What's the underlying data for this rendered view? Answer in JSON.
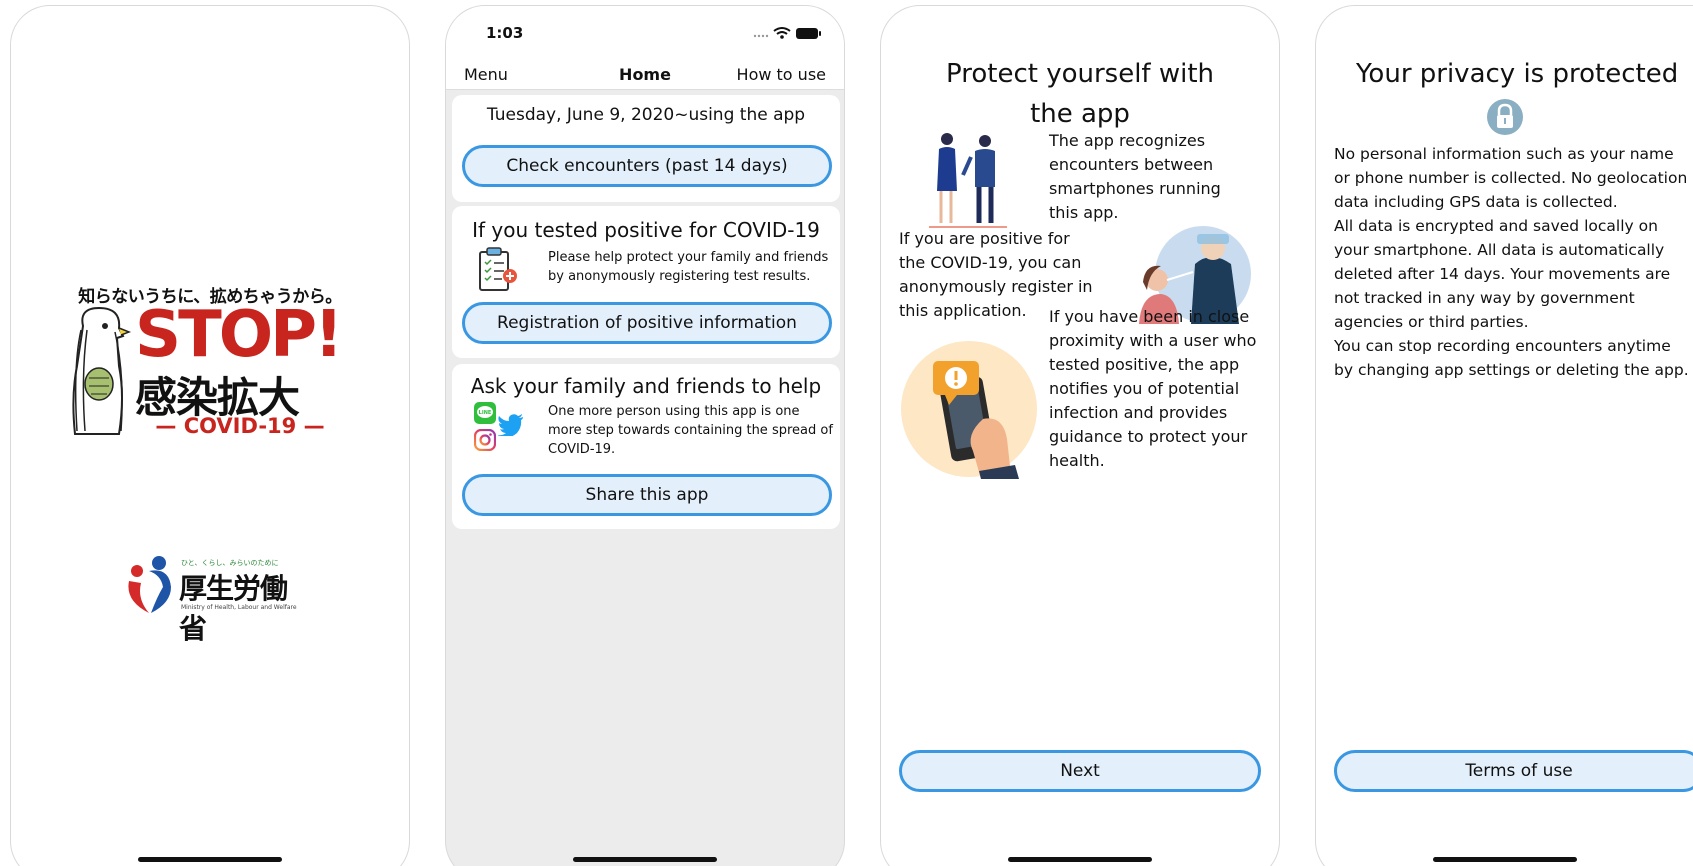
{
  "splash": {
    "slogan": "知らないうちに、拡めちゃうから。",
    "stop": "STOP!",
    "kanji": "感染拡大",
    "covid": "— COVID-19 —",
    "ministry_tagline": "ひと、くらし、みらいのために",
    "ministry_name": "厚生労働省",
    "ministry_en": "Ministry of Health, Labour and Welfare"
  },
  "home": {
    "status_time": "1:03",
    "nav": {
      "left": "Menu",
      "center": "Home",
      "right": "How to use"
    },
    "usage_line": "Tuesday, June 9, 2020~using the app",
    "check_button": "Check encounters (past 14 days)",
    "positive_title": "If you tested positive for COVID-19",
    "positive_desc": "Please help protect your family and friends by anonymously registering test results.",
    "register_button": "Registration of positive information",
    "share_title": "Ask your family and friends to help",
    "share_desc": "One more person using this app is one more step towards containing the spread of COVID-19.",
    "share_button": "Share this app",
    "line_label": "LINE"
  },
  "onboarding": {
    "title": "Protect yourself with the app",
    "p1": "The app recognizes encounters between smartphones running this app.",
    "p2": "If you are positive for the COVID-19, you can anonymously register in this application.",
    "p3": "If you have been in close proximity with a user who tested positive, the app notifies you of potential infection and provides guidance to protect your health.",
    "next_button": "Next"
  },
  "privacy": {
    "title": "Your privacy is protected",
    "p1": "No personal information such as your name or phone number is collected. No geolocation data including GPS data is collected.",
    "p2": "All data is encrypted and saved locally on your smartphone. All data is automatically deleted after 14 days. Your movements are not tracked in any way by government agencies or third parties.",
    "p3": "You can stop recording encounters anytime by changing app settings or deleting the app.",
    "terms_button": "Terms of use"
  },
  "colors": {
    "accent": "#3a97e2",
    "pill_fill": "#e3f0fb",
    "stop_red": "#c8251f"
  }
}
